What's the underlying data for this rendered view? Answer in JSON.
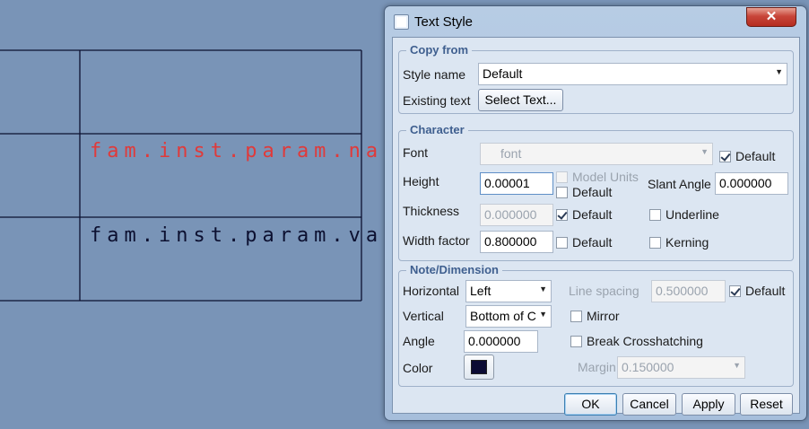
{
  "drawing": {
    "text_row1": "fam.inst.param.name",
    "text_row2": "fam.inst.param.value",
    "row1_color": "#e03a3a",
    "row2_color": "#0c1030"
  },
  "dialog": {
    "title": "Text Style",
    "title_icon": "window-icon",
    "close_glyph": "✕",
    "copy_from": {
      "legend": "Copy from",
      "style_name_label": "Style name",
      "style_name_value": "Default",
      "existing_text_label": "Existing text",
      "select_text_button": "Select Text..."
    },
    "character": {
      "legend": "Character",
      "font_label": "Font",
      "font_value": "font",
      "font_default_label": "Default",
      "height_label": "Height",
      "height_value": "0.00001",
      "model_units_label": "Model Units",
      "height_default_label": "Default",
      "slant_angle_label": "Slant Angle",
      "slant_angle_value": "0.000000",
      "thickness_label": "Thickness",
      "thickness_value": "0.000000",
      "thickness_default_label": "Default",
      "underline_label": "Underline",
      "width_factor_label": "Width factor",
      "width_factor_value": "0.800000",
      "width_default_label": "Default",
      "kerning_label": "Kerning"
    },
    "note_dimension": {
      "legend": "Note/Dimension",
      "horizontal_label": "Horizontal",
      "horizontal_value": "Left",
      "line_spacing_label": "Line spacing",
      "line_spacing_value": "0.500000",
      "line_spacing_default_label": "Default",
      "vertical_label": "Vertical",
      "vertical_value": "Bottom of C",
      "mirror_label": "Mirror",
      "angle_label": "Angle",
      "angle_value": "0.000000",
      "break_crosshatching_label": "Break Crosshatching",
      "color_label": "Color",
      "color_value": "#0b0b33",
      "margin_label": "Margin",
      "margin_value": "0.150000"
    },
    "buttons": {
      "ok": "OK",
      "cancel": "Cancel",
      "apply": "Apply",
      "reset": "Reset"
    },
    "checkbox_states": {
      "font_default": true,
      "model_units": false,
      "height_default": false,
      "thickness_default": true,
      "underline": false,
      "width_default": false,
      "kerning": false,
      "line_spacing_default": true,
      "mirror": false,
      "break_crosshatching": false
    }
  }
}
